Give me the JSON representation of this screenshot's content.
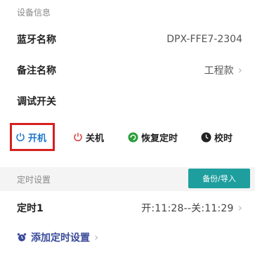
{
  "device_info": {
    "section_title": "设备信息",
    "bluetooth_name_label": "蓝牙名称",
    "bluetooth_name_value": "DPX-FFE7-2304",
    "note_name_label": "备注名称",
    "note_name_value": "工程款",
    "debug_switch_label": "调试开关"
  },
  "operations": {
    "power_on_label": "开机",
    "power_off_label": "关机",
    "resume_timer_label": "恢复定时",
    "sync_time_label": "校时"
  },
  "timer": {
    "section_title": "定时设置",
    "backup_import_label": "备份/导入",
    "timer1_label": "定时1",
    "timer1_value": "开:11:28--关:11:29",
    "add_timer_label": "添加定时设置"
  },
  "colors": {
    "accent_blue": "#1f77c9",
    "highlight_red": "#d62020",
    "power_off_red": "#d64242",
    "resume_green": "#2a9d3a",
    "teal_button": "#1f9e9e",
    "add_link": "#3b4b9a"
  },
  "icons": {
    "power_on": "power-icon",
    "power_off": "power-icon",
    "resume": "refresh-icon",
    "sync": "clock-icon",
    "add": "alarm-clock-icon",
    "chevron": "chevron-right-icon"
  }
}
